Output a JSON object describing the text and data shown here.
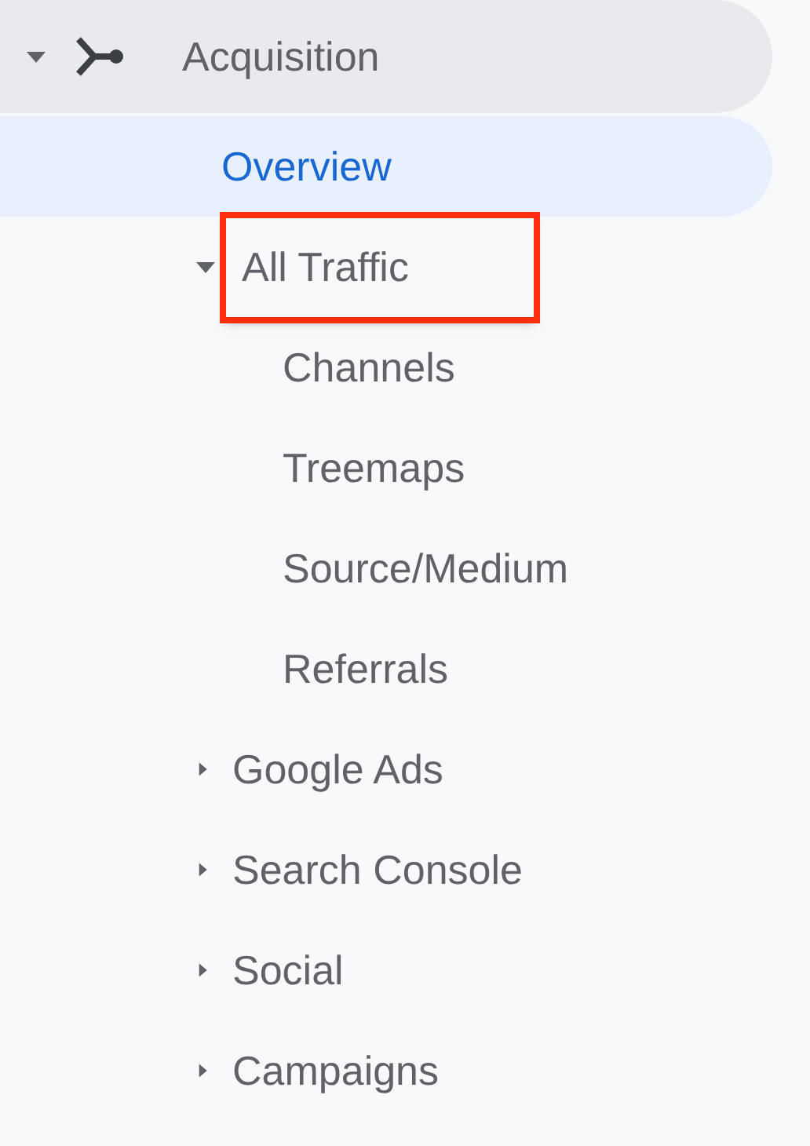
{
  "section": {
    "label": "Acquisition",
    "expanded": true
  },
  "items": [
    {
      "kind": "leaf",
      "label": "Overview",
      "selected": true
    },
    {
      "kind": "group",
      "label": "All Traffic",
      "selected": false,
      "expanded": true,
      "highlighted": true,
      "children": [
        {
          "label": "Channels",
          "selected": false
        },
        {
          "label": "Treemaps",
          "selected": false
        },
        {
          "label": "Source/Medium",
          "selected": false
        },
        {
          "label": "Referrals",
          "selected": false
        }
      ]
    },
    {
      "kind": "group",
      "label": "Google Ads",
      "selected": false,
      "expanded": false,
      "highlighted": false
    },
    {
      "kind": "group",
      "label": "Search Console",
      "selected": false,
      "expanded": false,
      "highlighted": false
    },
    {
      "kind": "group",
      "label": "Social",
      "selected": false,
      "expanded": false,
      "highlighted": false
    },
    {
      "kind": "group",
      "label": "Campaigns",
      "selected": false,
      "expanded": false,
      "highlighted": false
    }
  ]
}
